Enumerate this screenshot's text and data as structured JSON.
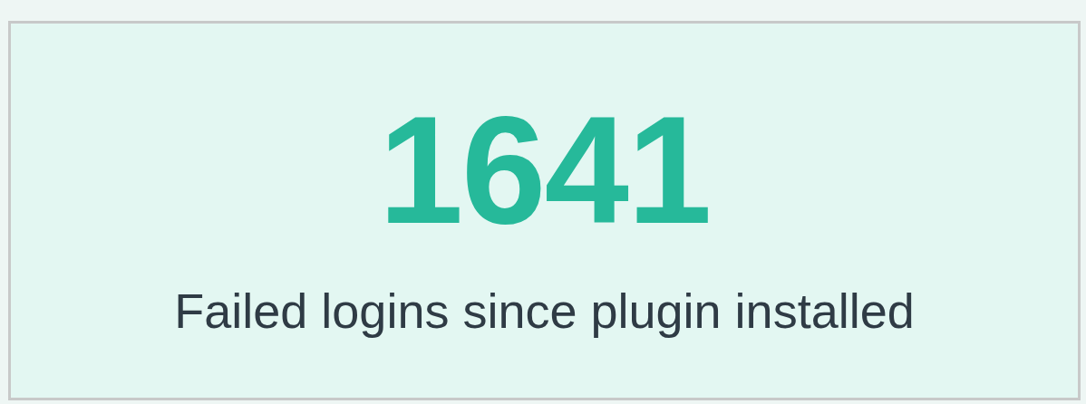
{
  "stat": {
    "value": "1641",
    "label": "Failed logins since plugin installed"
  }
}
